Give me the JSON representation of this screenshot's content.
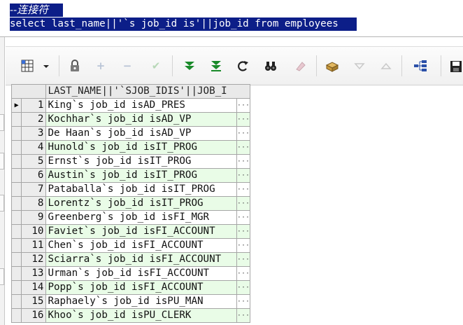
{
  "editor": {
    "comment_line": "--连接符",
    "sql_line": "select last_name||'`s job_id is'||job_id from employees"
  },
  "toolbar": {
    "icons": [
      "grid-view-icon",
      "dropdown-arrow-icon",
      "lock-icon",
      "plus-icon",
      "minus-icon",
      "check-icon",
      "fetch-next-icon",
      "fetch-all-icon",
      "refresh-icon",
      "find-icon",
      "clear-icon",
      "export-icon",
      "sort-desc-icon",
      "sort-asc-icon",
      "tree-view-icon",
      "save-icon"
    ]
  },
  "grid": {
    "column_header": "LAST_NAME||'`SJOB_IDIS'||JOB_I",
    "rows": [
      {
        "n": "1",
        "value": "King`s job_id isAD_PRES"
      },
      {
        "n": "2",
        "value": "Kochhar`s job_id isAD_VP"
      },
      {
        "n": "3",
        "value": "De Haan`s job_id isAD_VP"
      },
      {
        "n": "4",
        "value": "Hunold`s job_id isIT_PROG"
      },
      {
        "n": "5",
        "value": "Ernst`s job_id isIT_PROG"
      },
      {
        "n": "6",
        "value": "Austin`s job_id isIT_PROG"
      },
      {
        "n": "7",
        "value": "Pataballa`s job_id isIT_PROG"
      },
      {
        "n": "8",
        "value": "Lorentz`s job_id isIT_PROG"
      },
      {
        "n": "9",
        "value": "Greenberg`s job_id isFI_MGR"
      },
      {
        "n": "10",
        "value": "Faviet`s job_id isFI_ACCOUNT"
      },
      {
        "n": "11",
        "value": "Chen`s job_id isFI_ACCOUNT"
      },
      {
        "n": "12",
        "value": "Sciarra`s job_id isFI_ACCOUNT"
      },
      {
        "n": "13",
        "value": "Urman`s job_id isFI_ACCOUNT"
      },
      {
        "n": "14",
        "value": "Popp`s job_id isFI_ACCOUNT"
      },
      {
        "n": "15",
        "value": "Raphaely`s job_id isPU_MAN"
      },
      {
        "n": "16",
        "value": "Khoo`s job_id isPU_CLERK"
      }
    ]
  },
  "colors": {
    "selection": "#0c1e88",
    "alt_row": "#e9fce7"
  }
}
